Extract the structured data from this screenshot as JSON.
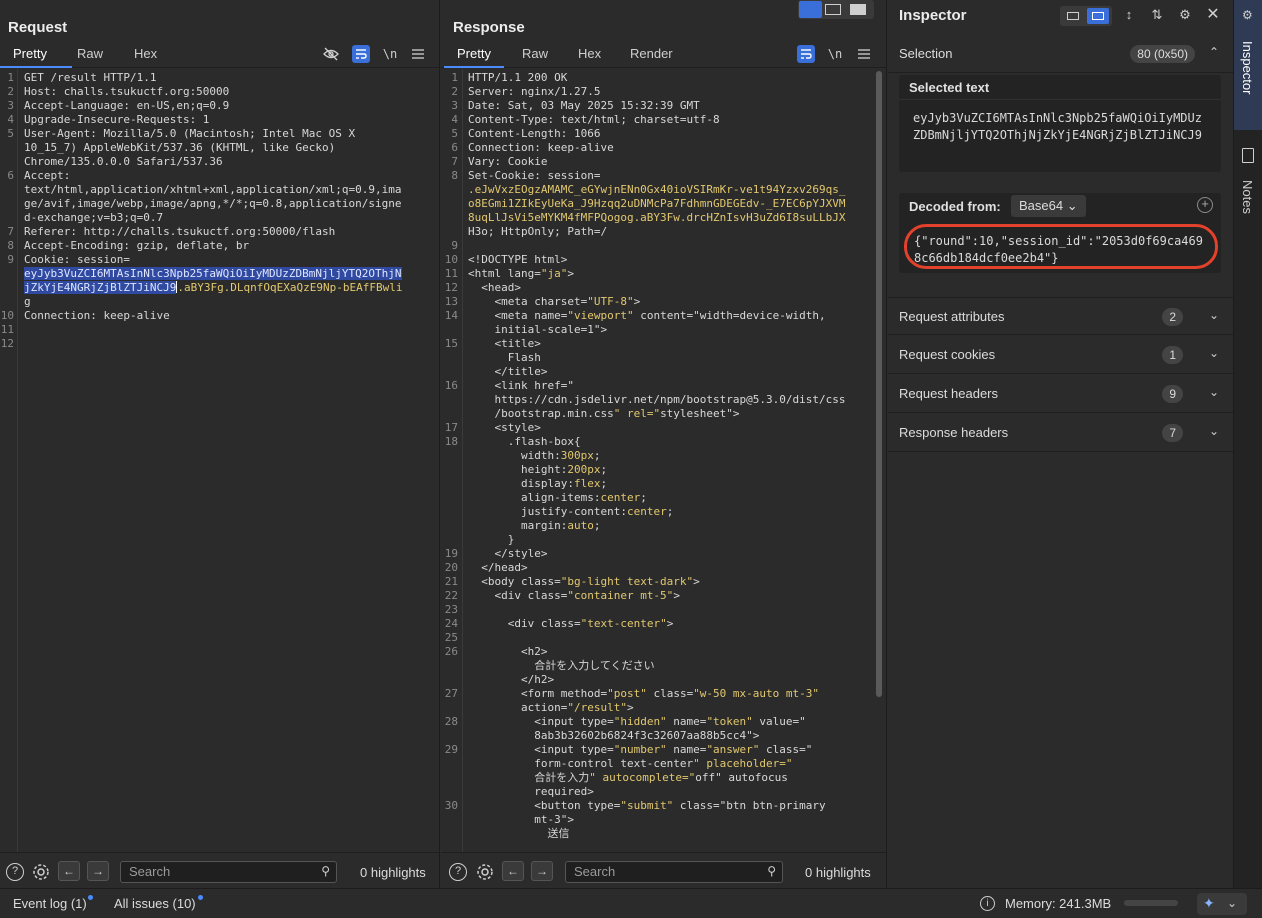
{
  "request": {
    "title": "Request",
    "tabs": [
      "Pretty",
      "Raw",
      "Hex"
    ],
    "lines": [
      {
        "n": "1",
        "t": "GET /result HTTP/1.1"
      },
      {
        "n": "2",
        "t": "Host: challs.tsukuctf.org:50000"
      },
      {
        "n": "3",
        "t": "Accept-Language: en-US,en;q=0.9"
      },
      {
        "n": "4",
        "t": "Upgrade-Insecure-Requests: 1"
      },
      {
        "n": "5",
        "t": "User-Agent: Mozilla/5.0 (Macintosh; Intel Mac OS X"
      },
      {
        "n": "",
        "t": "10_15_7) AppleWebKit/537.36 (KHTML, like Gecko)"
      },
      {
        "n": "",
        "t": "Chrome/135.0.0.0 Safari/537.36"
      },
      {
        "n": "6",
        "t": "Accept:"
      },
      {
        "n": "",
        "t": "text/html,application/xhtml+xml,application/xml;q=0.9,ima"
      },
      {
        "n": "",
        "t": "ge/avif,image/webp,image/apng,*/*;q=0.8,application/signe"
      },
      {
        "n": "",
        "t": "d-exchange;v=b3;q=0.7"
      },
      {
        "n": "7",
        "t": "Referer: http://challs.tsukuctf.org:50000/flash"
      },
      {
        "n": "8",
        "t": "Accept-Encoding: gzip, deflate, br"
      },
      {
        "n": "9",
        "t": "Cookie: session="
      },
      {
        "n": "",
        "sel": "eyJyb3VuZCI6MTAsInNlc3Npb25faWQiOiIyMDUzZDBmNjljYTQ2OThjN",
        "t": ""
      },
      {
        "n": "",
        "sel": "jZkYjE4NGRjZjBlZTJiNCJ9",
        "t": ".aBY3Fg.DLqnfOqEXaQzE9Np-bEAfFBwli",
        "cursor": true
      },
      {
        "n": "",
        "t": "g"
      },
      {
        "n": "10",
        "t": "Connection: keep-alive"
      },
      {
        "n": "11",
        "t": ""
      },
      {
        "n": "12",
        "t": ""
      }
    ]
  },
  "response": {
    "title": "Response",
    "tabs": [
      "Pretty",
      "Raw",
      "Hex",
      "Render"
    ],
    "lines": [
      {
        "n": "1",
        "t": "HTTP/1.1 200 OK",
        "hl": true
      },
      {
        "n": "2",
        "t": "Server: nginx/1.27.5"
      },
      {
        "n": "3",
        "t": "Date: Sat, 03 May 2025 15:32:39 GMT"
      },
      {
        "n": "4",
        "t": "Content-Type: text/html; charset=utf-8"
      },
      {
        "n": "5",
        "t": "Content-Length: 1066"
      },
      {
        "n": "6",
        "t": "Connection: keep-alive"
      },
      {
        "n": "7",
        "t": "Vary: Cookie"
      },
      {
        "n": "8",
        "t": "Set-Cookie: session="
      },
      {
        "n": "",
        "t": ".eJwVxzEOgzAMAMC_eGYwjnENn0Gx40ioVSIRmKr-ve1t94Yzxv269qs_",
        "c": "str"
      },
      {
        "n": "",
        "t": "o8EGmi1ZIkEyUeKa_J9Hzqq2uDNMcPa7FdhmnGDEGEdv-_E7EC6pYJXVM",
        "c": "str"
      },
      {
        "n": "",
        "t": "8uqLlJsVi5eMYKM4fMFPQogog.aBY3Fw.drcHZnIsvH3uZd6I8suLLbJX",
        "c": "str"
      },
      {
        "n": "",
        "t": "H3o; HttpOnly; Path=/",
        "mix": true
      },
      {
        "n": "9",
        "t": ""
      },
      {
        "n": "10",
        "t": "<!DOCTYPE html>"
      },
      {
        "n": "11",
        "t": "<html lang=\"ja\">"
      },
      {
        "n": "12",
        "t": "  <head>"
      },
      {
        "n": "13",
        "t": "    <meta charset=\"UTF-8\">"
      },
      {
        "n": "14",
        "t": "    <meta name=\"viewport\" content=\"width=device-width,"
      },
      {
        "n": "",
        "t": "    initial-scale=1\">"
      },
      {
        "n": "15",
        "t": "    <title>"
      },
      {
        "n": "",
        "t": "      Flash"
      },
      {
        "n": "",
        "t": "    </title>"
      },
      {
        "n": "16",
        "t": "    <link href=\""
      },
      {
        "n": "",
        "t": "    https://cdn.jsdelivr.net/npm/bootstrap@5.3.0/dist/css"
      },
      {
        "n": "",
        "t": "    /bootstrap.min.css\" rel=\"stylesheet\">"
      },
      {
        "n": "17",
        "t": "    <style>"
      },
      {
        "n": "18",
        "t": "      .flash-box{"
      },
      {
        "n": "",
        "t": "        width:300px;"
      },
      {
        "n": "",
        "t": "        height:200px;"
      },
      {
        "n": "",
        "t": "        display:flex;"
      },
      {
        "n": "",
        "t": "        align-items:center;"
      },
      {
        "n": "",
        "t": "        justify-content:center;"
      },
      {
        "n": "",
        "t": "        margin:auto;"
      },
      {
        "n": "",
        "t": "      }"
      },
      {
        "n": "19",
        "t": "    </style>"
      },
      {
        "n": "20",
        "t": "  </head>"
      },
      {
        "n": "21",
        "t": "  <body class=\"bg-light text-dark\">"
      },
      {
        "n": "22",
        "t": "    <div class=\"container mt-5\">"
      },
      {
        "n": "23",
        "t": ""
      },
      {
        "n": "24",
        "t": "      <div class=\"text-center\">"
      },
      {
        "n": "25",
        "t": ""
      },
      {
        "n": "26",
        "t": "        <h2>"
      },
      {
        "n": "",
        "t": "          合計を入力してください"
      },
      {
        "n": "",
        "t": "        </h2>"
      },
      {
        "n": "27",
        "t": "        <form method=\"post\" class=\"w-50 mx-auto mt-3\""
      },
      {
        "n": "",
        "t": "        action=\"/result\">"
      },
      {
        "n": "28",
        "t": "          <input type=\"hidden\" name=\"token\" value=\""
      },
      {
        "n": "",
        "t": "          8ab3b32602b6824f3c32607aa88b5cc4\">"
      },
      {
        "n": "29",
        "t": "          <input type=\"number\" name=\"answer\" class=\""
      },
      {
        "n": "",
        "t": "          form-control text-center\" placeholder=\""
      },
      {
        "n": "",
        "t": "          合計を入力\" autocomplete=\"off\" autofocus"
      },
      {
        "n": "",
        "t": "          required>"
      },
      {
        "n": "30",
        "t": "          <button type=\"submit\" class=\"btn btn-primary"
      },
      {
        "n": "",
        "t": "          mt-3\">"
      },
      {
        "n": "",
        "t": "            送信"
      }
    ]
  },
  "search": {
    "placeholder": "Search",
    "highlights": "0 highlights"
  },
  "inspector": {
    "title": "Inspector",
    "selection_label": "Selection",
    "selection_badge": "80 (0x50)",
    "selected_text_label": "Selected text",
    "selected_text": "eyJyb3VuZCI6MTAsInNlc3Npb25faWQiOiIyMDUzZDBmNjljYTQ2OThjNjZkYjE4NGRjZjBlZTJiNCJ9",
    "decoded_from_label": "Decoded from:",
    "decoded_from_value": "Base64",
    "decoded_text": "{\"round\":10,\"session_id\":\"2053d0f69ca4698c66db184dcf0ee2b4\"}",
    "sections": [
      {
        "label": "Request attributes",
        "count": "2"
      },
      {
        "label": "Request cookies",
        "count": "1"
      },
      {
        "label": "Request headers",
        "count": "9"
      },
      {
        "label": "Response headers",
        "count": "7"
      }
    ]
  },
  "side_rail": {
    "inspector": "Inspector",
    "notes": "Notes"
  },
  "footer": {
    "event_log": "Event log (1)",
    "all_issues": "All issues (10)",
    "memory": "Memory: 241.3MB"
  }
}
